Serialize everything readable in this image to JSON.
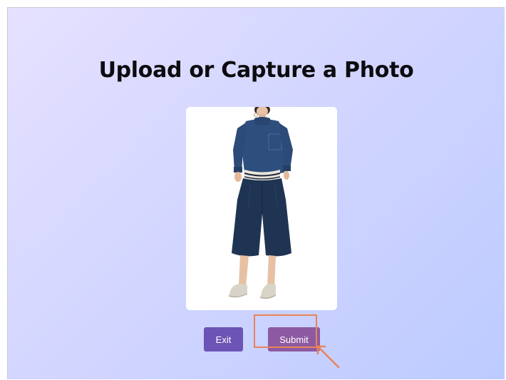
{
  "page": {
    "title": "Upload or Capture a Photo"
  },
  "photo": {
    "subject": "person wearing navy denim sweatshirt and wide-leg culottes with white sneakers"
  },
  "buttons": {
    "exit_label": "Exit",
    "submit_label": "Submit"
  },
  "colors": {
    "background_start": "#e6e1ff",
    "background_end": "#bccbff",
    "exit_button": "#6b54b5",
    "submit_button": "#8d5aa1",
    "highlight": "#e8845a"
  }
}
